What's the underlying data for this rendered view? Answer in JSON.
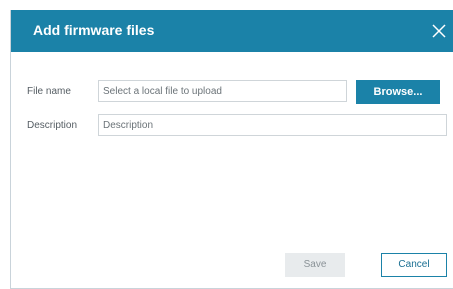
{
  "dialog": {
    "title": "Add firmware files",
    "close_icon": "close-icon"
  },
  "form": {
    "file_name_label": "File name",
    "file_name_placeholder": "Select a local file to upload",
    "description_label": "Description",
    "description_placeholder": "Description"
  },
  "buttons": {
    "browse_label": "Browse...",
    "save_label": "Save",
    "cancel_label": "Cancel"
  },
  "colors": {
    "accent": "#1b82a8",
    "disabled_button_bg": "#e8ebed"
  }
}
